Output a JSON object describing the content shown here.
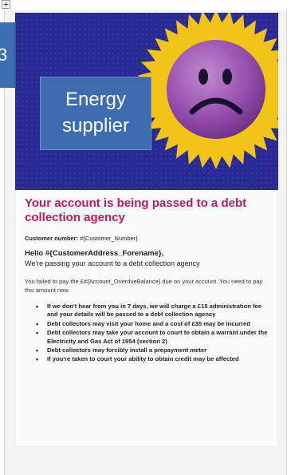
{
  "slide": {
    "number": "3"
  },
  "callout": {
    "line1": "Energy",
    "line2": "supplier"
  },
  "email": {
    "headline": "Your account is being passed to a debt collection agency",
    "customer_label": "Customer number:",
    "customer_value": "#{Customer_Number}",
    "greeting": "Hello #{CustomerAddress_Forename},",
    "intro": "We're passing your account to a debt collection agency",
    "failed_text": "You failed to pay the £#{Account_OverdueBalance} due on your account. You need to pay this amount now.",
    "bullets": [
      "If we don't hear from you in 7 days, we will charge a £15 administration fee and your details will be passed to a debt collection agency",
      "Debt collectors may visit your home and a cost of £35 may be incurred",
      "Debt collectors may take your account to court to obtain a warrant under the Electricity and Gas Act of 1954 (section 2)",
      "Debt collectors may forcibly install a prepayment meter",
      "If you're taken to court your ability to obtain credit may be affected"
    ]
  },
  "colors": {
    "hero_background": "#2a2a95",
    "burst": "#f2c318",
    "face": "#a05ab4",
    "headline": "#c0175f",
    "callout": "#3d6db0"
  },
  "icons": {
    "expand": "expand-icon",
    "sad_face": "sad-face-icon"
  }
}
